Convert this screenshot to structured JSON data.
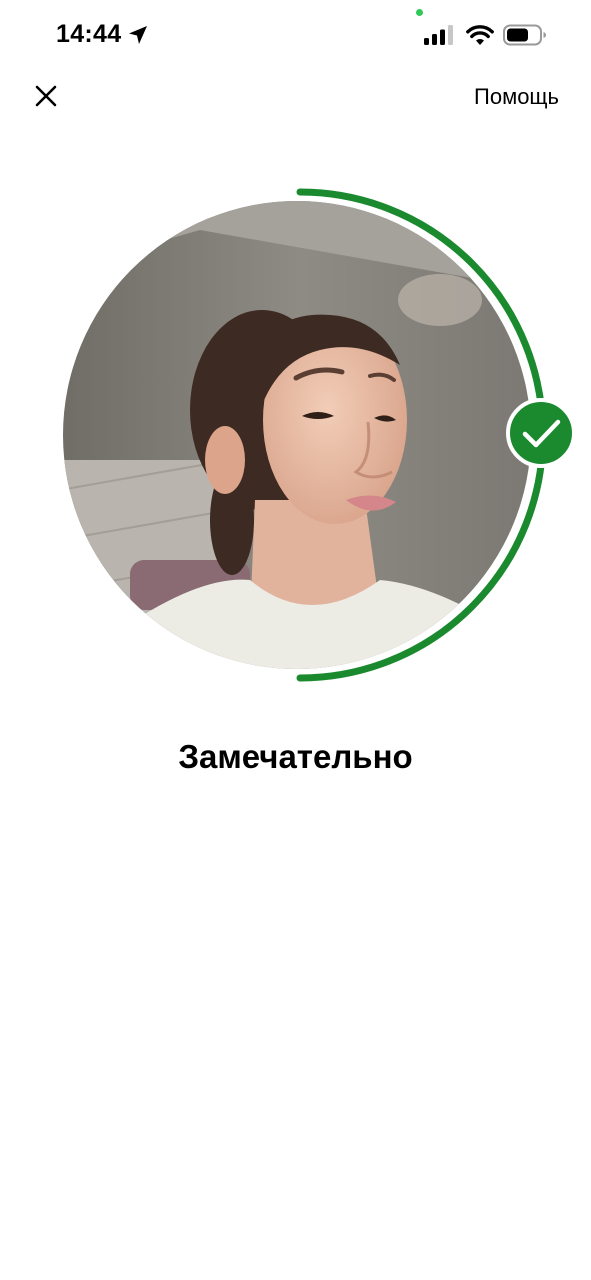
{
  "status_bar": {
    "time": "14:44",
    "icons": [
      "location-arrow-icon",
      "signal-icon",
      "wifi-icon",
      "battery-icon"
    ]
  },
  "nav": {
    "close_icon": "close-icon",
    "help_label": "Помощь"
  },
  "capture": {
    "status_icon": "checkmark-icon",
    "progress": 0.5,
    "accent_color": "#1b8a2f"
  },
  "result": {
    "title": "Замечательно"
  }
}
